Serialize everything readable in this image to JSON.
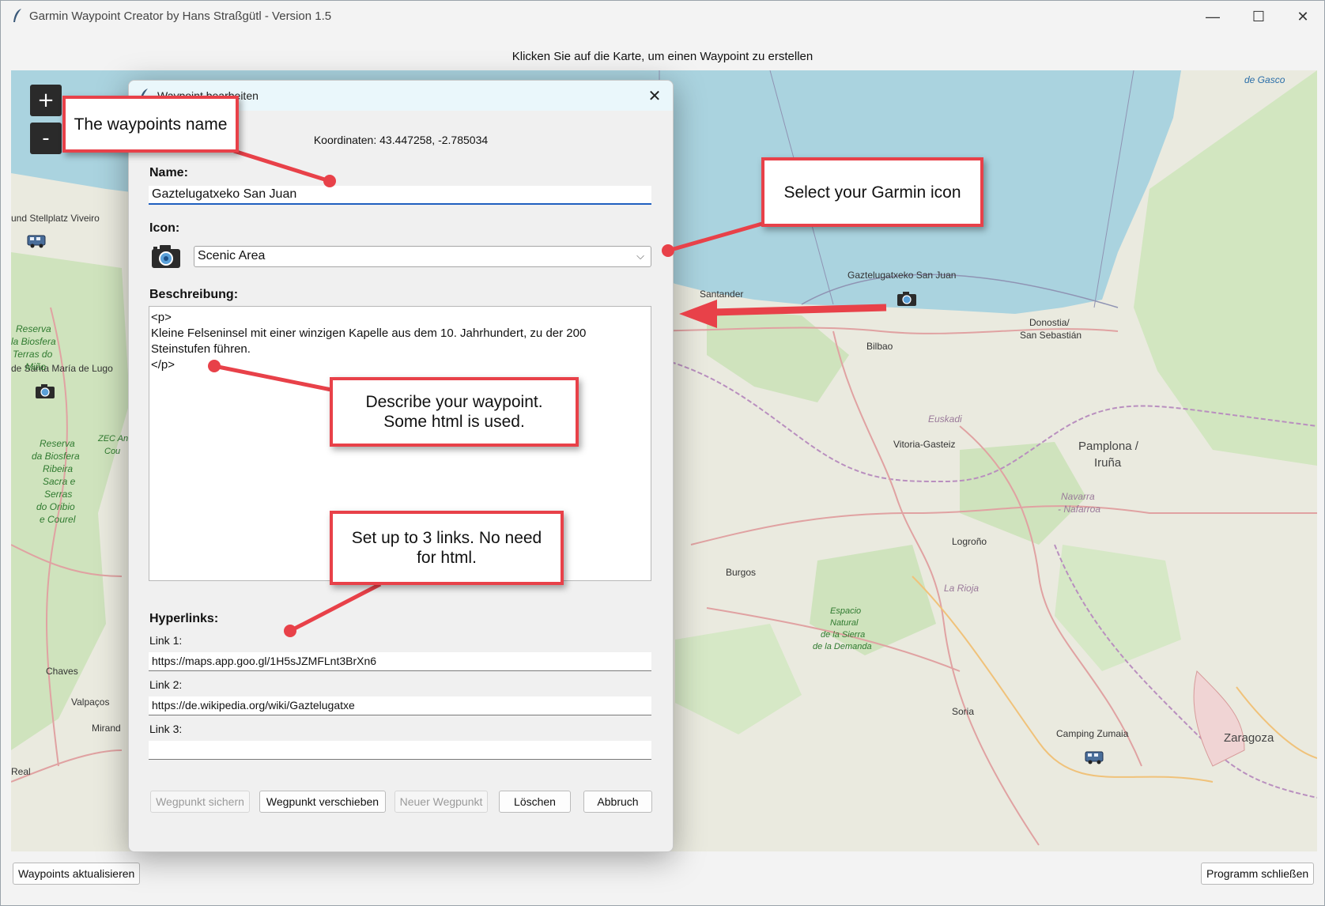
{
  "window": {
    "title": "Garmin Waypoint Creator by Hans Straßgütl - Version 1.5",
    "minimize_glyph": "—",
    "maximize_glyph": "☐",
    "close_glyph": "✕"
  },
  "hint": "Klicken Sie auf die Karte, um einen Waypoint zu erstellen",
  "map": {
    "zoom_in": "+",
    "zoom_out": "-",
    "labels": {
      "stellplatz": "und Stellplatz Viveiro",
      "santa_maria": "de Santa María de Lugo",
      "gaztelugatxe": "Gaztelugatxeko San Juan",
      "santander": "Santander",
      "bilbao": "Bilbao",
      "donostia": "Donostia/",
      "san_sebastian": "San Sebastián",
      "euskadi": "Euskadi",
      "vitoria": "Vitoria-Gasteiz",
      "pamplona": "Pamplona /",
      "iruna": "Iruña",
      "navarra": "Navarra",
      "nafarroa": "- Nafarroa",
      "logrono": "Logroño",
      "burgos": "Burgos",
      "la_rioja": "La Rioja",
      "espacio": "Espacio",
      "natural": "Natural",
      "de_la_sierra": "de la Sierra",
      "de_la_demanda": "de la Demanda",
      "soria": "Soria",
      "camping_zumaia": "Camping Zumaia",
      "zaragoza": "Zaragoza",
      "chaves": "Chaves",
      "valpacos": "Valpaços",
      "mirande": "Mirand",
      "real": "Real",
      "de_gasco": "de Gasco",
      "reserva1": "Reserva",
      "biosfera1": "la Biosfera",
      "terras": "Terras do",
      "mino": "Miño",
      "reserva2": "Reserva",
      "biosfera2": "da Biosfera",
      "ribeira": "Ribeira",
      "sacra": "Sacra e",
      "serras": "Serras",
      "oribio": "do Oribio",
      "courel": "e Courel",
      "zec": "ZEC An",
      "cou": "Cou"
    }
  },
  "footer": {
    "refresh": "Waypoints aktualisieren",
    "close_app": "Programm schließen"
  },
  "dialog": {
    "title": "Waypoint bearbeiten",
    "close_glyph": "✕",
    "coordinates": "Koordinaten: 43.447258, -2.785034",
    "name_label": "Name:",
    "name_value": "Gaztelugatxeko San Juan",
    "icon_label": "Icon:",
    "icon_value": "Scenic Area",
    "icon_chevron": "⌵",
    "description_label": "Beschreibung:",
    "description_lines": [
      "<p>",
      "Kleine Felseninsel mit einer winzigen Kapelle aus dem 10. Jahrhundert, zu der 200",
      "Steinstufen führen.",
      "</p>"
    ],
    "hyperlinks_label": "Hyperlinks:",
    "link1_label": "Link 1:",
    "link1_value": "https://maps.app.goo.gl/1H5sJZMFLnt3BrXn6",
    "link2_label": "Link 2:",
    "link2_value": "https://de.wikipedia.org/wiki/Gaztelugatxe",
    "link3_label": "Link 3:",
    "link3_value": "",
    "buttons": {
      "save": "Wegpunkt sichern",
      "move": "Wegpunkt verschieben",
      "new": "Neuer Wegpunkt",
      "delete": "Löschen",
      "cancel": "Abbruch"
    }
  },
  "callouts": {
    "name": "The waypoints name",
    "icon": "Select your Garmin icon",
    "description": [
      "Describe your waypoint.",
      "Some html is used."
    ],
    "links": [
      "Set up to 3 links. No need",
      "for html."
    ]
  },
  "colors": {
    "callout_border": "#e84149",
    "sea": "#aad3df",
    "land": "#eaeadf",
    "forest": "#c8e0b4",
    "entry_focus": "#1f5fbf"
  },
  "icons": {
    "camera": "camera-icon",
    "rv": "rv-camper-icon",
    "app": "feather-icon"
  }
}
